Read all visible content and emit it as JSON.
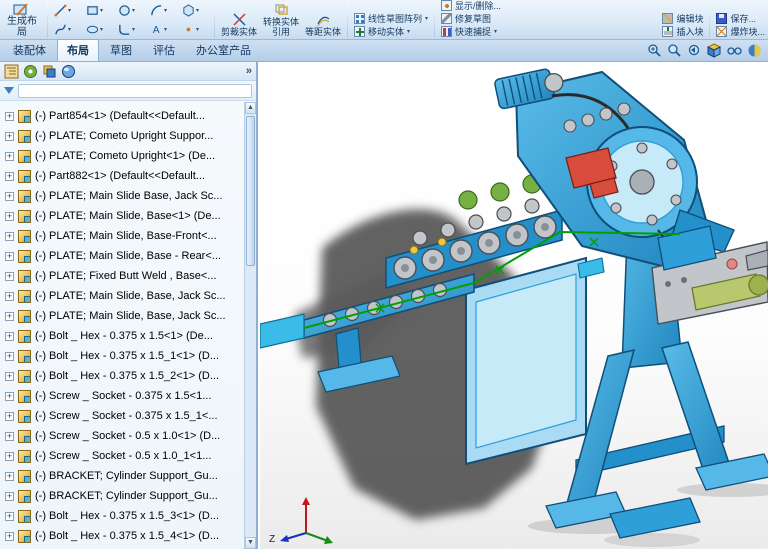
{
  "ribbon": {
    "create_layout": "生成布局",
    "trim": "剪裁实体",
    "convert": "转换实体引用",
    "offset": "等距实体",
    "stack_pattern": [
      "线性草图阵列",
      "移动实体"
    ],
    "stack_relations": [
      "显示/删除...",
      "修复草图",
      "快速捕捉"
    ],
    "edit_block": "编辑块",
    "insert_block": "插入块",
    "save_block": "保存...",
    "explode_block": "爆炸块..."
  },
  "tabs": [
    {
      "label": "装配体",
      "active": false
    },
    {
      "label": "布局",
      "active": true
    },
    {
      "label": "草图",
      "active": false
    },
    {
      "label": "评估",
      "active": false
    },
    {
      "label": "办公室产品",
      "active": false
    }
  ],
  "panel": {
    "chevron": "»"
  },
  "icons": {
    "caret_down": "▾",
    "scroll_up": "▲",
    "scroll_down": "▼",
    "expander_plus": "+"
  },
  "tree": {
    "items": [
      "(-) Part854<1> (Default<<Default...",
      "(-) PLATE; Cometo Upright Suppor...",
      "(-) PLATE; Cometo Upright<1> (De...",
      "(-) Part882<1> (Default<<Default...",
      "(-) PLATE; Main Slide Base, Jack Sc...",
      "(-) PLATE; Main Slide, Base<1> (De...",
      "(-) PLATE; Main Slide, Base-Front<...",
      "(-) PLATE; Main Slide, Base - Rear<...",
      "(-) PLATE; Fixed Butt Weld , Base<...",
      "(-) PLATE; Main Slide, Base, Jack Sc...",
      "(-) PLATE; Main Slide, Base, Jack Sc...",
      "(-) Bolt _ Hex - 0.375 x 1.5<1> (De...",
      "(-) Bolt _ Hex - 0.375 x 1.5_1<1> (D...",
      "(-) Bolt _ Hex - 0.375 x 1.5_2<1> (D...",
      "(-) Screw _ Socket - 0.375 x 1.5<1...",
      "(-) Screw _ Socket - 0.375 x 1.5_1<...",
      "(-) Screw _ Socket - 0.5 x 1.0<1> (D...",
      "(-) Screw _ Socket - 0.5 x 1.0_1<1...",
      "(-) BRACKET; Cylinder Support_Gu...",
      "(-) BRACKET; Cylinder Support_Gu...",
      "(-) Bolt _ Hex - 0.375 x 1.5_3<1> (D...",
      "(-) Bolt _ Hex - 0.375 x 1.5_4<1> (D..."
    ]
  },
  "viewport": {
    "triad_z": "Z"
  },
  "colors": {
    "machine_blue": "#2e9fd8",
    "machine_light_blue": "#a9dcf4",
    "wire_green": "#00a000",
    "shadow_gray": "#4e4e4e",
    "accent_red": "#d84c3c"
  }
}
